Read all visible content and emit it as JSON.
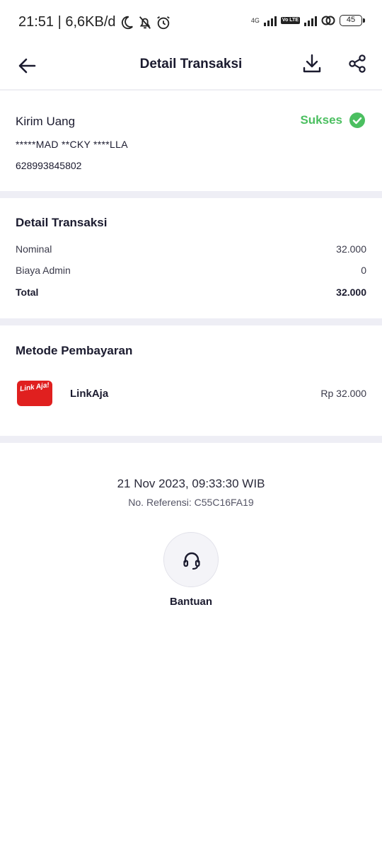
{
  "status_bar": {
    "time_speed": "21:51 | 6,6KB/d",
    "network": "4G",
    "volte": "Vo LTE",
    "battery": "45"
  },
  "header": {
    "title": "Detail Transaksi",
    "icons": [
      "arrow-left-icon",
      "download-icon",
      "share-icon"
    ]
  },
  "transfer": {
    "type": "Kirim Uang",
    "status": "Sukses",
    "recipient_name": "*****MAD **CKY ****LLA",
    "recipient_phone": "628993845802"
  },
  "details": {
    "heading": "Detail Transaksi",
    "rows": [
      {
        "label": "Nominal",
        "value": "32.000"
      },
      {
        "label": "Biaya Admin",
        "value": "0"
      },
      {
        "label": "Total",
        "value": "32.000"
      }
    ]
  },
  "payment": {
    "heading": "Metode Pembayaran",
    "logo_text": "Link Aja!",
    "method": "LinkAja",
    "amount": "Rp 32.000"
  },
  "footer": {
    "datetime": "21 Nov 2023, 09:33:30 WIB",
    "reference": "No. Referensi: C55C16FA19",
    "help_label": "Bantuan"
  },
  "colors": {
    "success": "#4bbf60",
    "brand_red": "#e0201f",
    "divider": "#eeeef5"
  }
}
